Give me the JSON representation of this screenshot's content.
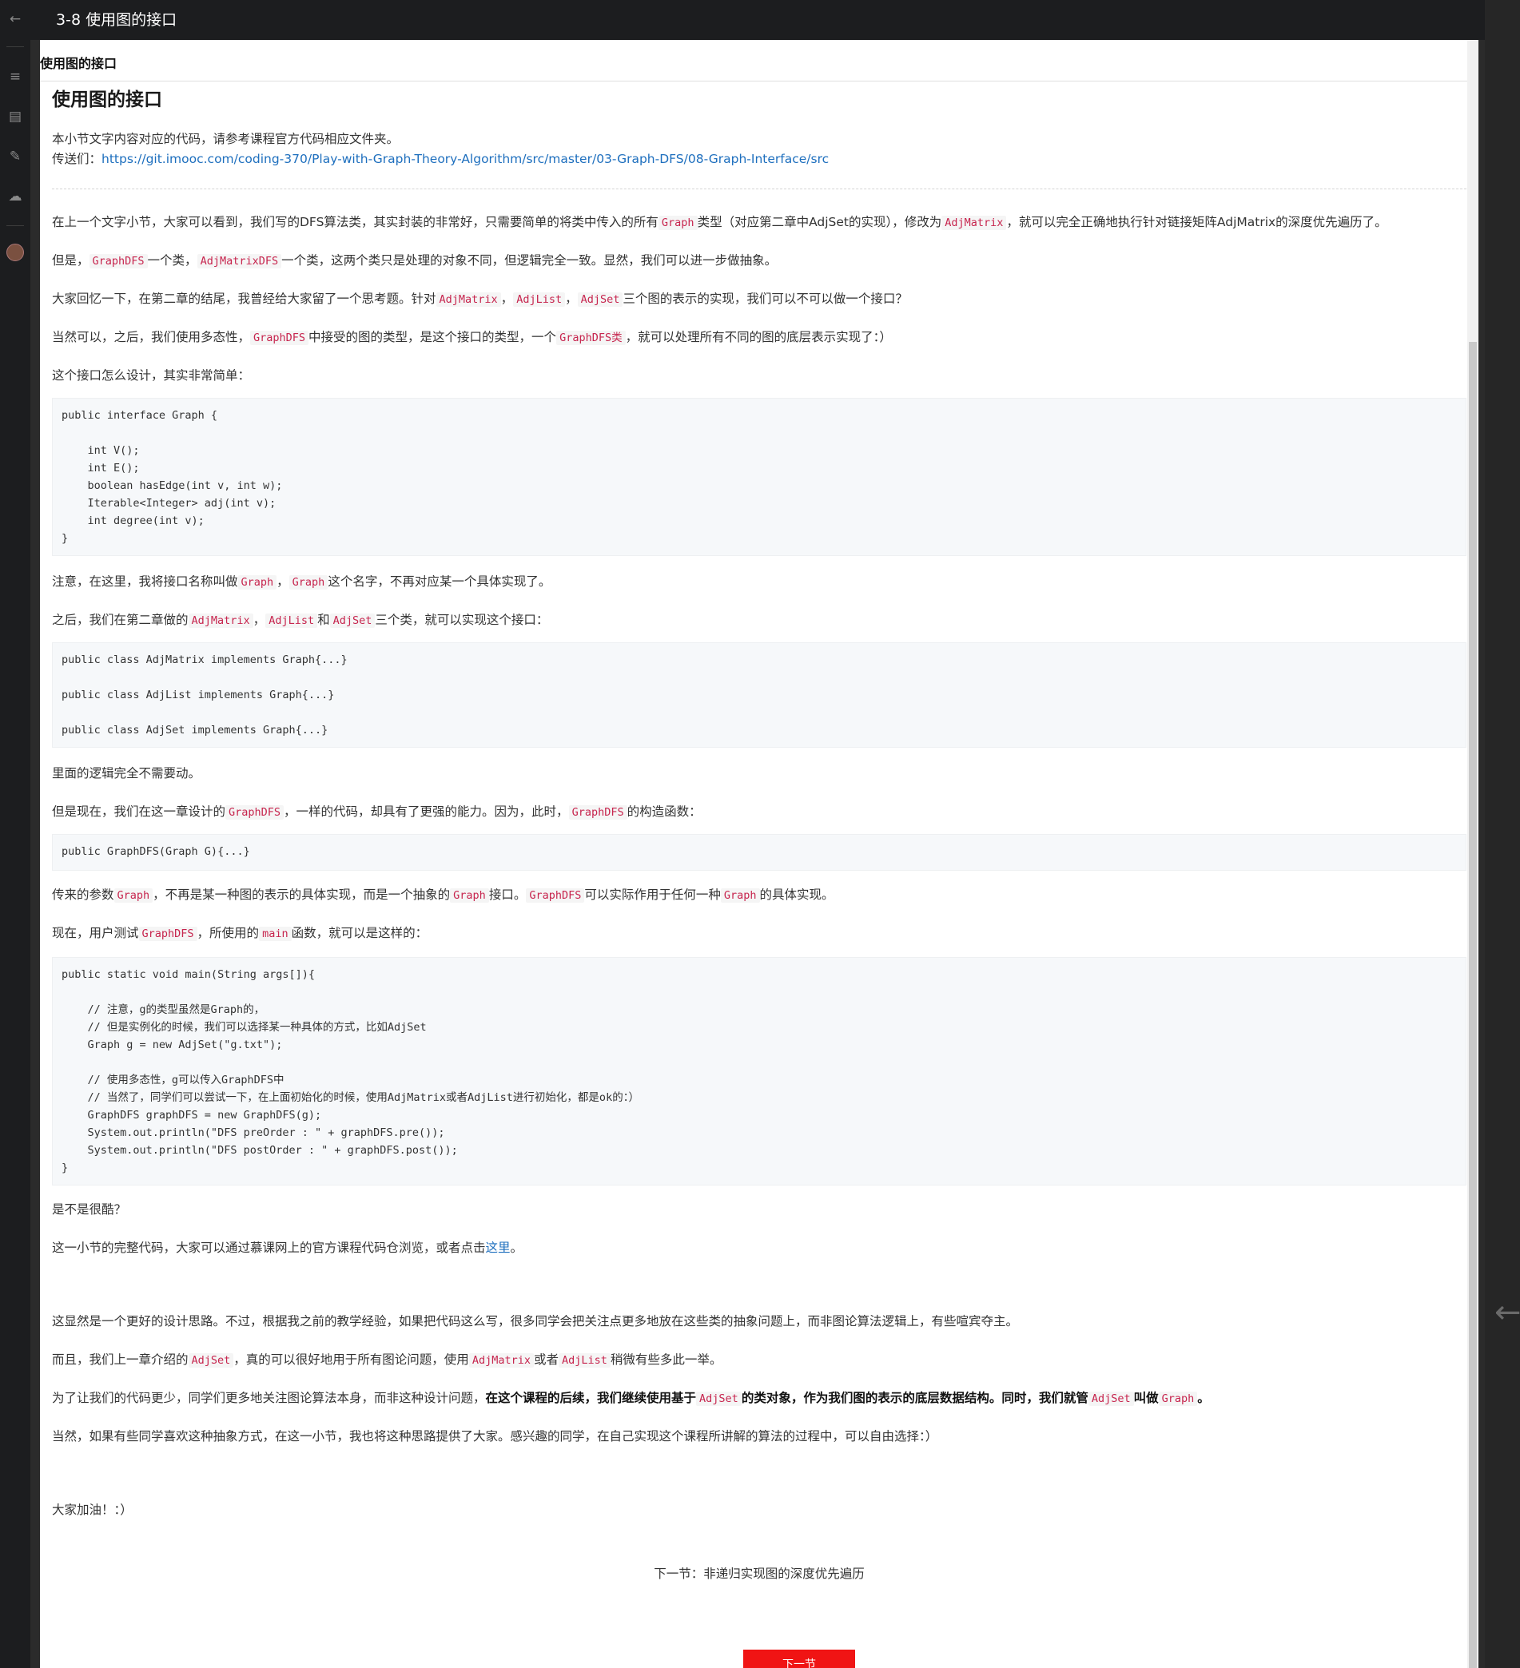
{
  "window": {
    "title": "3-8 使用图的接口"
  },
  "sidebar": {
    "icons": [
      "back-arrow-icon",
      "menu-icon",
      "question-icon",
      "edit-pencil-icon",
      "cloud-download-icon"
    ]
  },
  "breadcrumb": "使用图的接口",
  "article": {
    "title": "使用图的接口",
    "intro_line1": "本小节文字内容对应的代码，请参考课程官方代码相应文件夹。",
    "intro_prefix": "传送们：",
    "intro_link": "https://git.imooc.com/coding-370/Play-with-Graph-Theory-Algorithm/src/master/03-Graph-DFS/08-Graph-Interface/src",
    "p1": {
      "a": "在上一个文字小节，大家可以看到，我们写的DFS算法类，其实封装的非常好，只需要简单的将类中传入的所有",
      "code1": "Graph",
      "b": "类型（对应第二章中AdjSet的实现），修改为",
      "code2": "AdjMatrix",
      "c": "，就可以完全正确地执行针对链接矩阵AdjMatrix的深度优先遍历了。"
    },
    "p2": {
      "a": "但是，",
      "code1": "GraphDFS",
      "b": "一个类，",
      "code2": "AdjMatrixDFS",
      "c": "一个类，这两个类只是处理的对象不同，但逻辑完全一致。显然，我们可以进一步做抽象。"
    },
    "p3": {
      "a": "大家回忆一下，在第二章的结尾，我曾经给大家留了一个思考题。针对",
      "code1": "AdjMatrix",
      "sep1": "，",
      "code2": "AdjList",
      "sep2": "，",
      "code3": "AdjSet",
      "b": "三个图的表示的实现，我们可以不可以做一个接口？"
    },
    "p4": {
      "a": "当然可以，之后，我们使用多态性，",
      "code1": "GraphDFS",
      "b": "中接受的图的类型，是这个接口的类型，一个",
      "code2": "GraphDFS类",
      "c": "，就可以处理所有不同的图的底层表示实现了：）"
    },
    "p5": "这个接口怎么设计，其实非常简单：",
    "code_block1": "public interface Graph {\n\n    int V();\n    int E();\n    boolean hasEdge(int v, int w);\n    Iterable<Integer> adj(int v);\n    int degree(int v);\n}",
    "p6": {
      "a": "注意，在这里，我将接口名称叫做",
      "code1": "Graph",
      "sep": "，",
      "code2": "Graph",
      "b": "这个名字，不再对应某一个具体实现了。"
    },
    "p7": {
      "a": "之后，我们在第二章做的",
      "code1": "AdjMatrix",
      "sep1": "，",
      "code2": "AdjList",
      "b": "和",
      "code3": "AdjSet",
      "c": "三个类，就可以实现这个接口："
    },
    "code_block2": "public class AdjMatrix implements Graph{...}\n\npublic class AdjList implements Graph{...}\n\npublic class AdjSet implements Graph{...}",
    "p8": "里面的逻辑完全不需要动。",
    "p9": {
      "a": "但是现在，我们在这一章设计的",
      "code1": "GraphDFS",
      "b": "，一样的代码，却具有了更强的能力。因为，此时，",
      "code2": "GraphDFS",
      "c": "的构造函数："
    },
    "code_block3": "public GraphDFS(Graph G){...}",
    "p10": {
      "a": "传来的参数",
      "code1": "Graph",
      "b": "，不再是某一种图的表示的具体实现，而是一个抽象的",
      "code2": "Graph",
      "c": "接口。",
      "code3": "GraphDFS",
      "d": "可以实际作用于任何一种",
      "code4": "Graph",
      "e": "的具体实现。"
    },
    "p11": {
      "a": "现在，用户测试",
      "code1": "GraphDFS",
      "b": "，所使用的",
      "code2": "main",
      "c": "函数，就可以是这样的："
    },
    "code_block4": "public static void main(String args[]){\n\n    // 注意，g的类型虽然是Graph的，\n    // 但是实例化的时候，我们可以选择某一种具体的方式，比如AdjSet\n    Graph g = new AdjSet(\"g.txt\");\n\n    // 使用多态性，g可以传入GraphDFS中\n    // 当然了，同学们可以尝试一下，在上面初始化的时候，使用AdjMatrix或者AdjList进行初始化，都是ok的：）\n    GraphDFS graphDFS = new GraphDFS(g);\n    System.out.println(\"DFS preOrder : \" + graphDFS.pre());\n    System.out.println(\"DFS postOrder : \" + graphDFS.post());\n}",
    "p12": "是不是很酷？",
    "p13": {
      "a": "这一小节的完整代码，大家可以通过慕课网上的官方课程代码仓浏览，或者点击",
      "link": "这里",
      "b": "。"
    },
    "p14": "这显然是一个更好的设计思路。不过，根据我之前的教学经验，如果把代码这么写，很多同学会把关注点更多地放在这些类的抽象问题上，而非图论算法逻辑上，有些喧宾夺主。",
    "p15": {
      "a": "而且，我们上一章介绍的",
      "code1": "AdjSet",
      "b": "，真的可以很好地用于所有图论问题，使用",
      "code2": "AdjMatrix",
      "c": "或者",
      "code3": "AdjList",
      "d": "稍微有些多此一举。"
    },
    "p16": {
      "a": "为了让我们的代码更少，同学们更多地关注图论算法本身，而非这种设计问题，",
      "bold1": "在这个课程的后续，我们继续使用基于",
      "code1": "AdjSet",
      "bold2": "的类对象，作为我们图的表示的底层数据结构。同时，我们就管",
      "code2": "AdjSet",
      "bold3": "叫做",
      "code3": "Graph",
      "bold4": "。"
    },
    "p17": "当然，如果有些同学喜欢这种抽象方式，在这一小节，我也将这种思路提供了大家。感兴趣的同学，在自己实现这个课程所讲解的算法的过程中，可以自由选择：）",
    "p18": "大家加油！：）"
  },
  "next": {
    "caption": "下一节：非递归实现图的深度优先遍历",
    "button_label": "下一节"
  },
  "colors": {
    "accent_red": "#f01414",
    "link_blue": "#1e6fbe",
    "code_red": "#c7254e"
  }
}
